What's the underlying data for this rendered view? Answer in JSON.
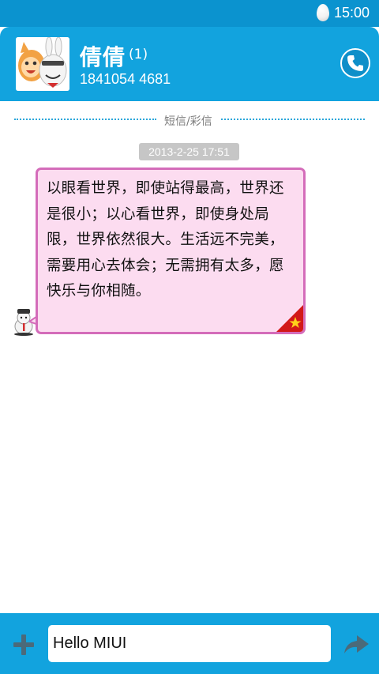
{
  "status_bar": {
    "time": "15:00",
    "icon": "egg-icon"
  },
  "header": {
    "name": "倩倩",
    "count": "(1)",
    "number": "1841054 4681",
    "call_icon": "phone-icon"
  },
  "conversation": {
    "divider_label": "短信/彩信",
    "timestamp": "2013-2-25 17:51",
    "message": {
      "lines": [
        "以眼看世界，即使站得最高，世界还",
        "是很小；以心看世界，即使身处局",
        "限，世界依然很大。生活远不完美，",
        "需要用心去体会；无需拥有太多，愿",
        "快乐与你相随。"
      ],
      "corner_icon": "star-icon"
    }
  },
  "composer": {
    "add_icon": "plus-icon",
    "input_value": "Hello MIUI",
    "send_icon": "send-arrow-icon"
  },
  "colors": {
    "header_bg": "#12a3de",
    "bubble_bg": "#fcdcf0",
    "bubble_border": "#d46cba"
  }
}
